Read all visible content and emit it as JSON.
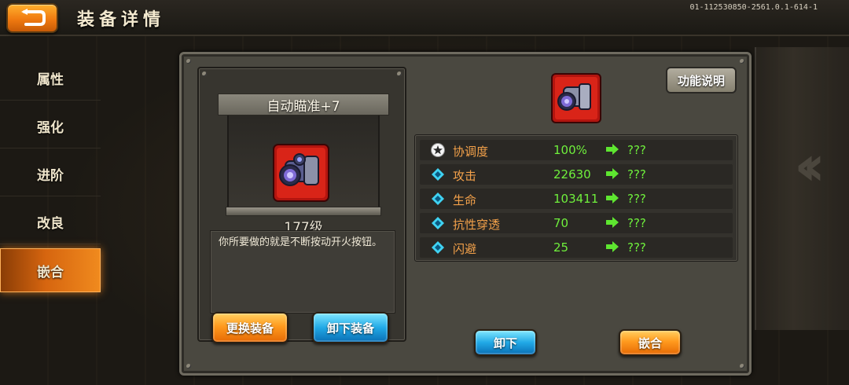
{
  "header": {
    "title": "装备详情",
    "version": "01-112530850-2561.0.1-614-1"
  },
  "sidebar": {
    "items": [
      {
        "label": "属性"
      },
      {
        "label": "强化"
      },
      {
        "label": "进阶"
      },
      {
        "label": "改良"
      },
      {
        "label": "嵌合"
      }
    ],
    "active_index": 4
  },
  "item": {
    "name": "自动瞄准+7",
    "level": "177级",
    "description": "你所要做的就是不断按动开火按钮。"
  },
  "buttons": {
    "replace": "更换装备",
    "unequip": "卸下装备",
    "function_info": "功能说明",
    "remove": "卸下",
    "embed": "嵌合"
  },
  "stats": [
    {
      "name": "协调度",
      "value": "100%",
      "next": "???",
      "icon": "star-icon"
    },
    {
      "name": "攻击",
      "value": "22630",
      "next": "???",
      "icon": "diamond-icon"
    },
    {
      "name": "生命",
      "value": "103411",
      "next": "???",
      "icon": "diamond-icon"
    },
    {
      "name": "抗性穿透",
      "value": "70",
      "next": "???",
      "icon": "diamond-icon"
    },
    {
      "name": "闪避",
      "value": "25",
      "next": "???",
      "icon": "diamond-icon"
    }
  ],
  "colors": {
    "accent_orange": "#f08a1e",
    "stat_name": "#f3a14a",
    "stat_value": "#6ff03c",
    "button_blue": "#21a9e6"
  }
}
